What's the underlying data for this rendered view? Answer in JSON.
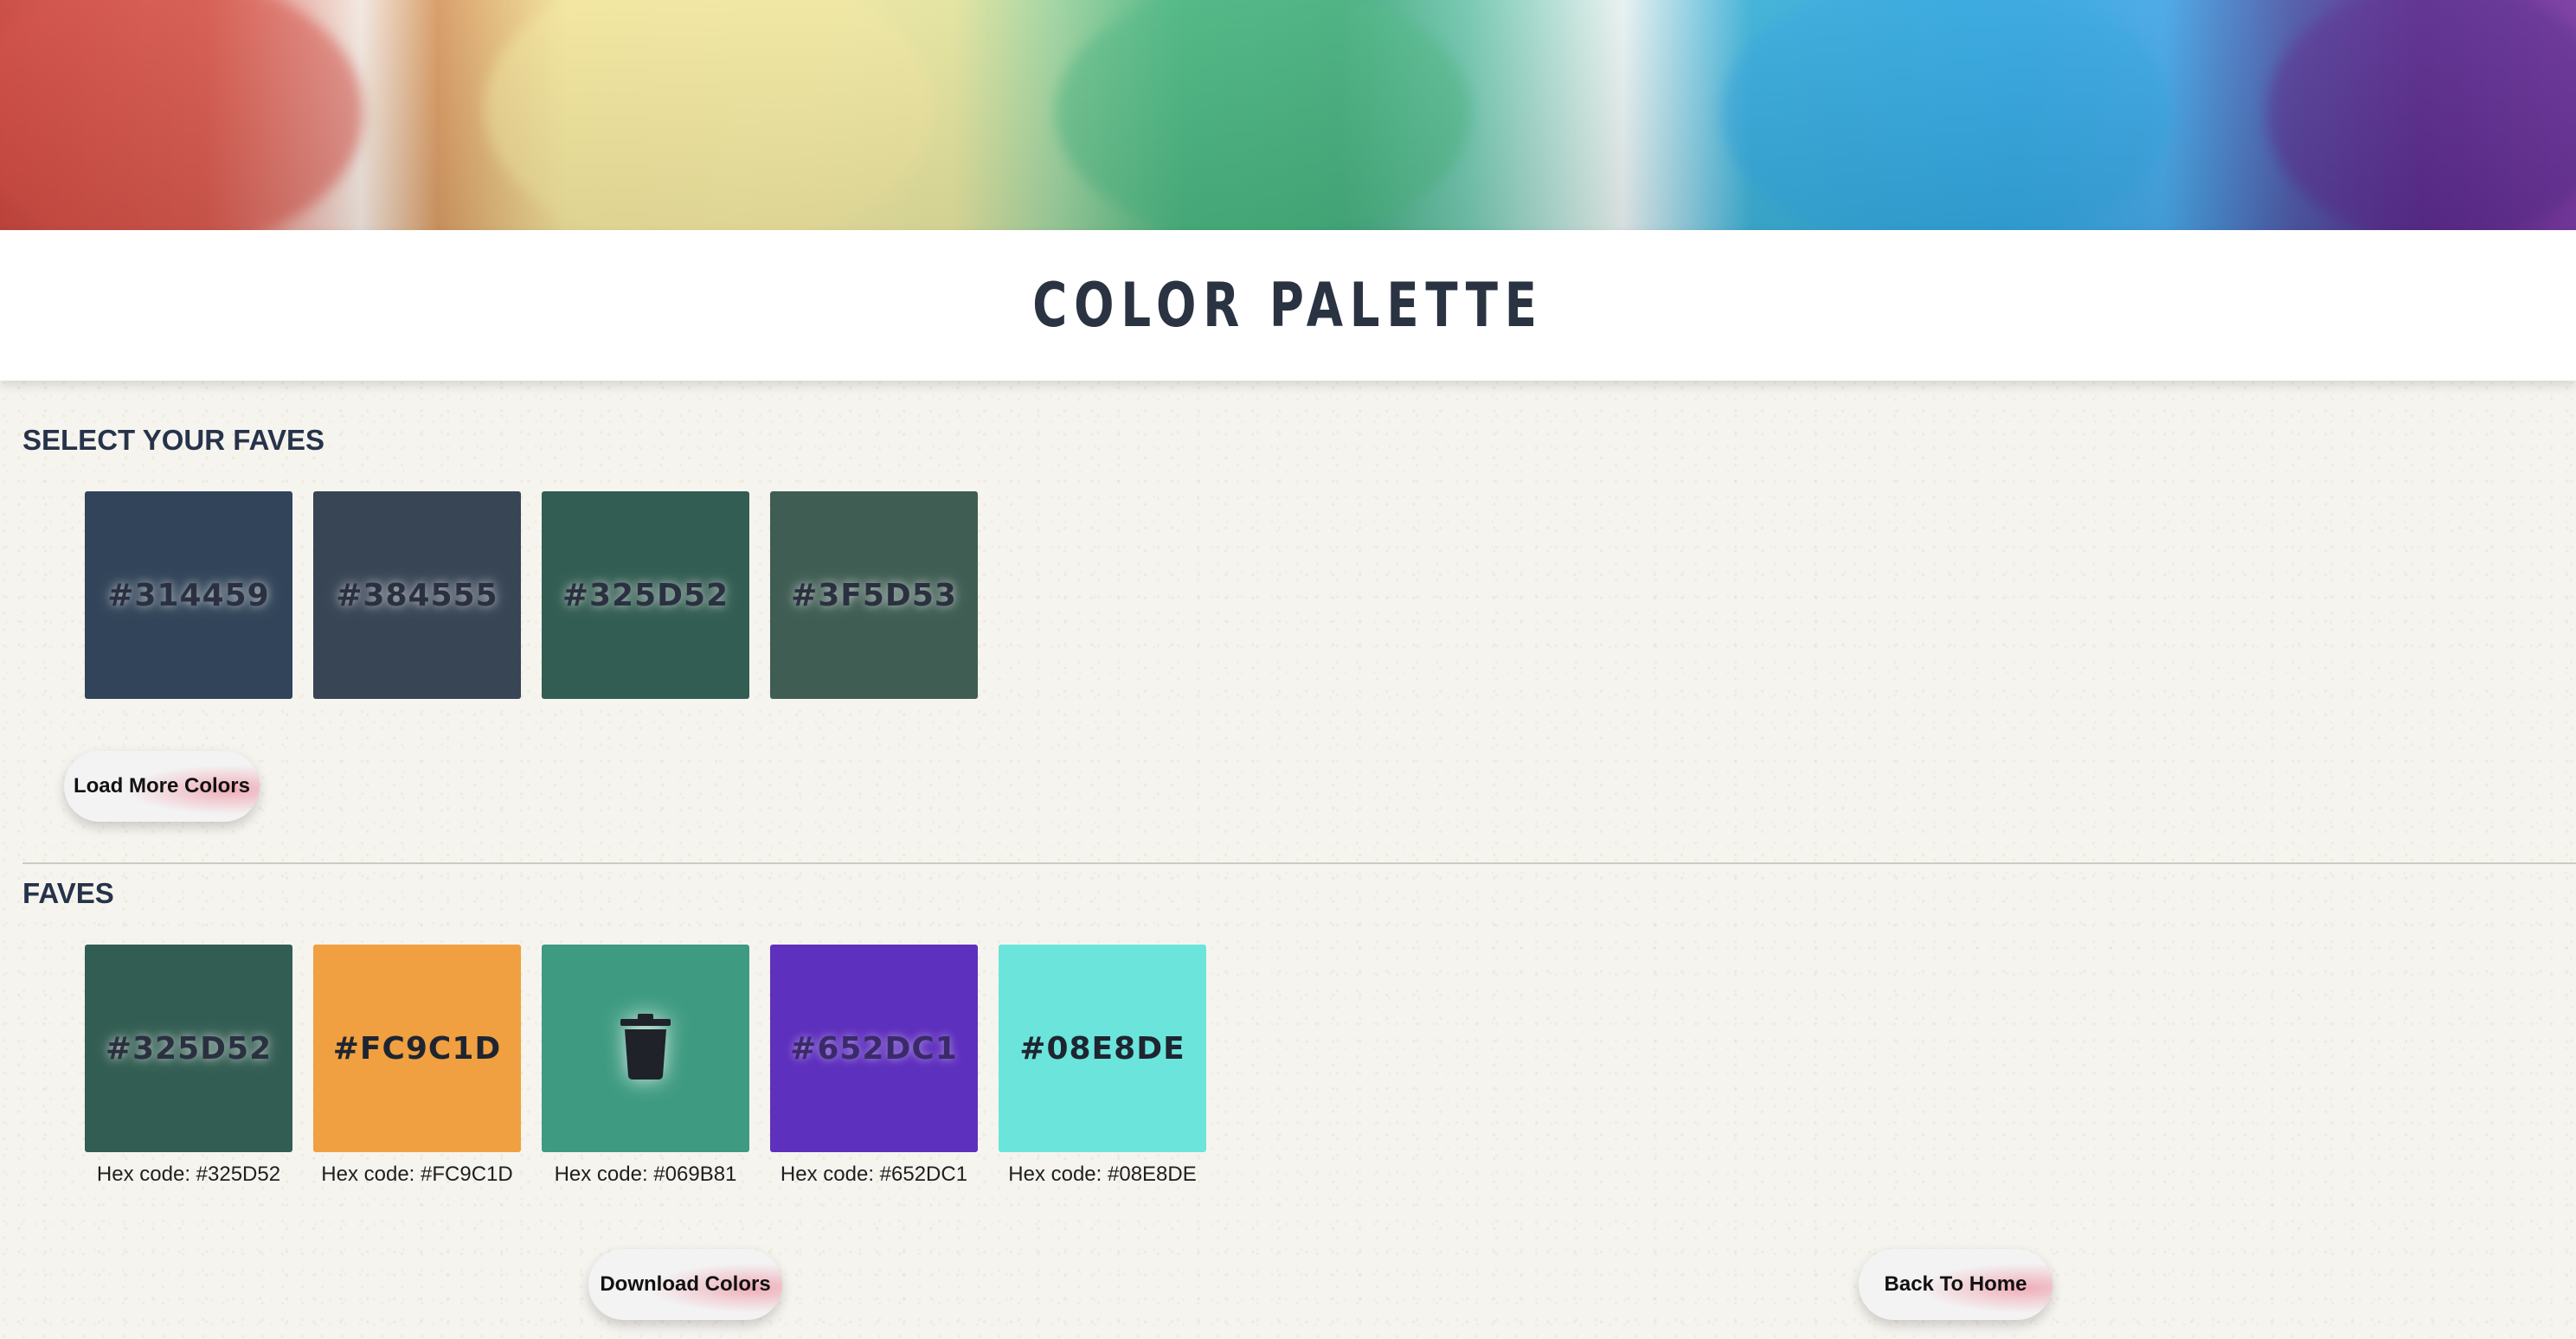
{
  "header": {
    "title": "COLOR PALETTE"
  },
  "select_section": {
    "heading": "SELECT YOUR FAVES",
    "swatches": [
      {
        "hex": "#314459",
        "color": "#314459"
      },
      {
        "hex": "#384555",
        "color": "#384555"
      },
      {
        "hex": "#325D52",
        "color": "#325D52"
      },
      {
        "hex": "#3F5D53",
        "color": "#3F5D53"
      }
    ],
    "load_more_label": "Load More Colors"
  },
  "faves_section": {
    "heading": "FAVES",
    "swatches": [
      {
        "hex": "#325D52",
        "color": "#325D52",
        "caption": "Hex code: #325D52"
      },
      {
        "hex": "#FC9C1D",
        "color": "#F0A040",
        "caption": "Hex code: #FC9C1D"
      },
      {
        "hex": "",
        "color": "#3E9B81",
        "caption": "Hex code: #069B81",
        "icon": "trash-icon"
      },
      {
        "hex": "#652DC1",
        "color": "#5E30BE",
        "caption": "Hex code: #652DC1"
      },
      {
        "hex": "#08E8DE",
        "color": "#6BE5DC",
        "caption": "Hex code: #08E8DE"
      }
    ]
  },
  "actions": {
    "download_label": "Download Colors",
    "home_label": "Back To Home"
  }
}
